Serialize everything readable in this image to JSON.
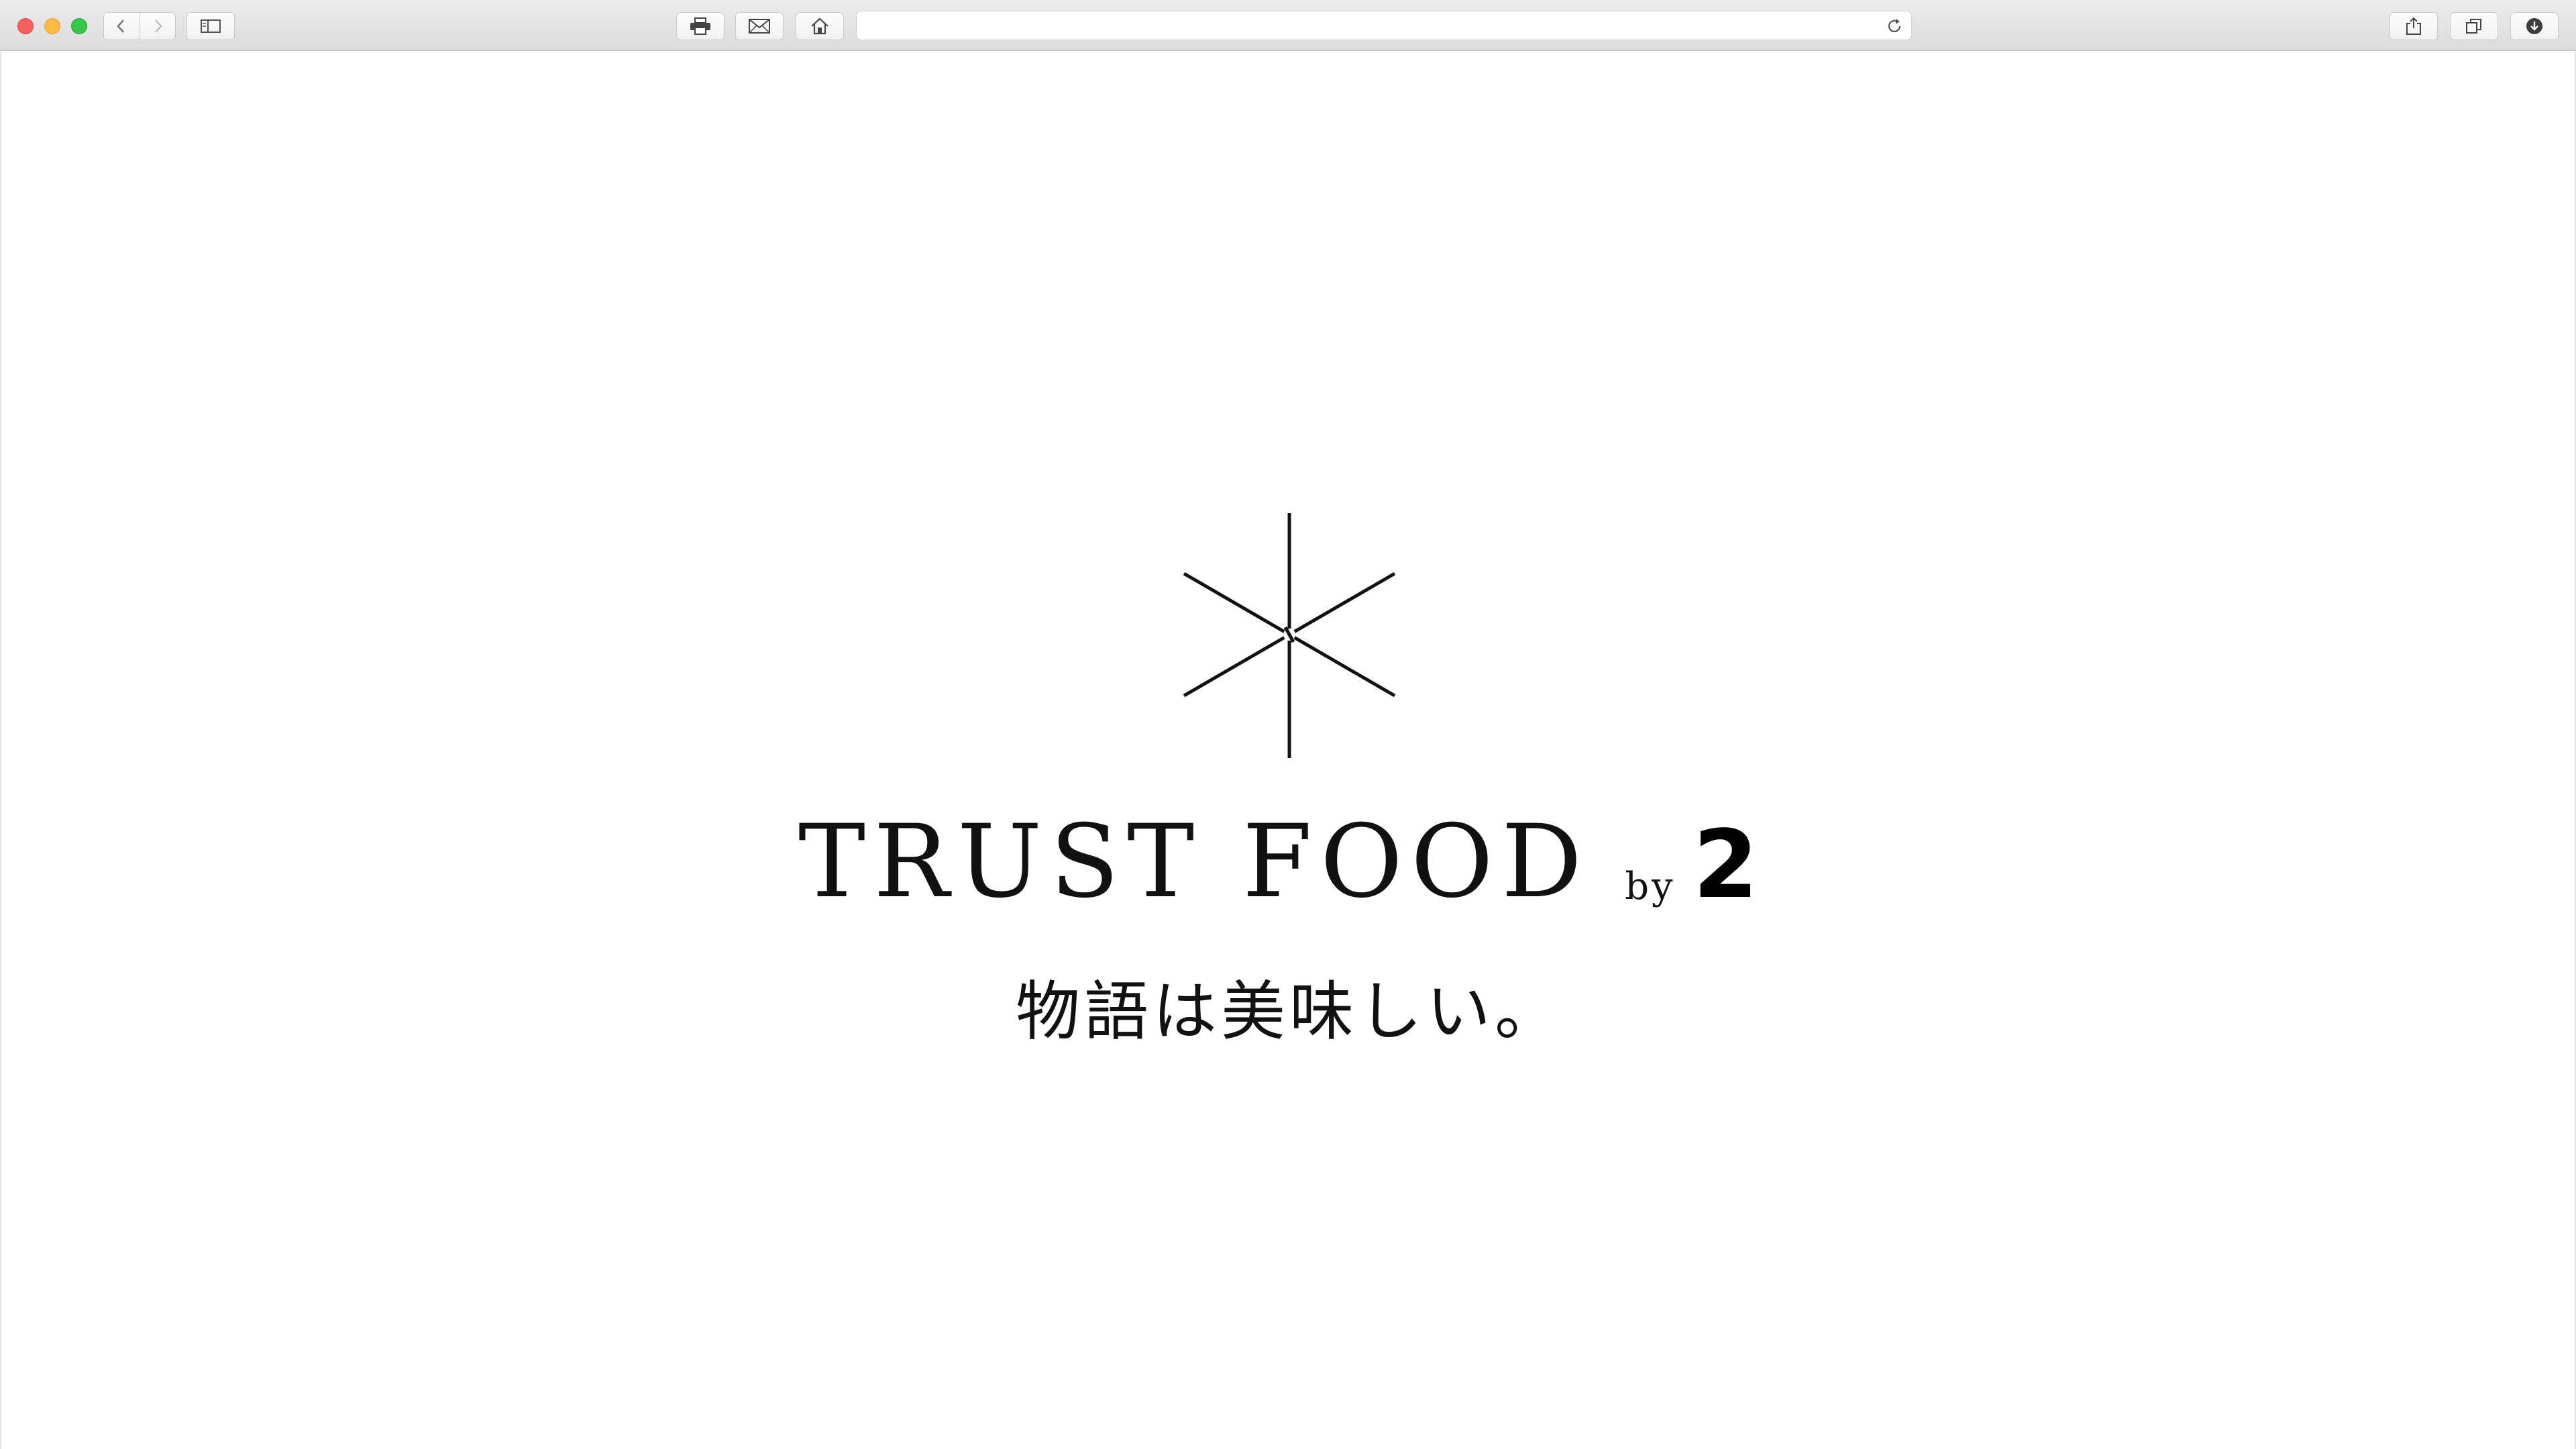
{
  "browser": {
    "url": "",
    "icons": {
      "back": "chevron-left-icon",
      "forward": "chevron-right-icon",
      "sidebar": "sidebar-icon",
      "print": "printer-icon",
      "mail": "mail-icon",
      "home": "home-icon",
      "reload": "reload-icon",
      "share": "share-icon",
      "tabs": "tabs-overview-icon",
      "downloads": "download-icon"
    },
    "traffic_colors": {
      "close": "#fc605c",
      "minimize": "#fdbc40",
      "maximize": "#34c84a"
    }
  },
  "page": {
    "logo_icon": "asterisk-snowflake-logo",
    "brand": {
      "title": "TRUST FOOD",
      "by": "by",
      "mark": "2"
    },
    "tagline": "物語は美味しい。"
  }
}
